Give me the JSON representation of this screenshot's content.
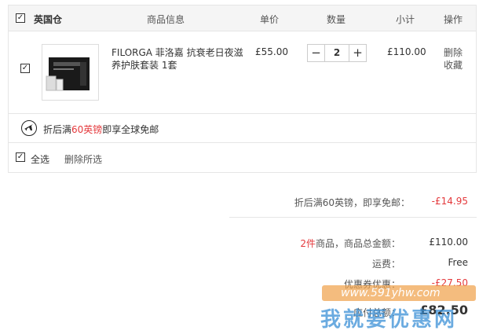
{
  "header": {
    "warehouse": "英国仓",
    "col_info": "商品信息",
    "col_price": "单价",
    "col_qty": "数量",
    "col_subtotal": "小计",
    "col_ops": "操作"
  },
  "item": {
    "name": "FILORGA 菲洛嘉 抗衰老日夜滋养护肤套装 1套",
    "price": "£55.00",
    "qty": "2",
    "subtotal": "£110.00",
    "delete": "删除",
    "favorite": "收藏",
    "minus": "−",
    "plus": "+"
  },
  "shipping": {
    "prefix": "折后满",
    "highlight": "60英镑",
    "suffix": "即享全球免邮"
  },
  "footer": {
    "select_all": "全选",
    "delete_selected": "删除所选"
  },
  "summary": {
    "discount_label": "折后满60英镑，即享免邮：",
    "discount_value": "-£14.95",
    "count": "2件",
    "total_label": "商品，商品总金额：",
    "total_value": "£110.00",
    "freight_label": "运费：",
    "freight_value": "Free",
    "coupon_label": "优惠券优惠：",
    "coupon_value": "-£27.50",
    "pay_label": "应付总额：",
    "pay_value": "£82.50"
  },
  "watermark": {
    "url": "www.591yhw.com",
    "text": "我就要优惠网"
  },
  "colors": {
    "accent": "#e4393c",
    "header_bg": "#f5f5f5",
    "border": "#e6e6e6"
  }
}
